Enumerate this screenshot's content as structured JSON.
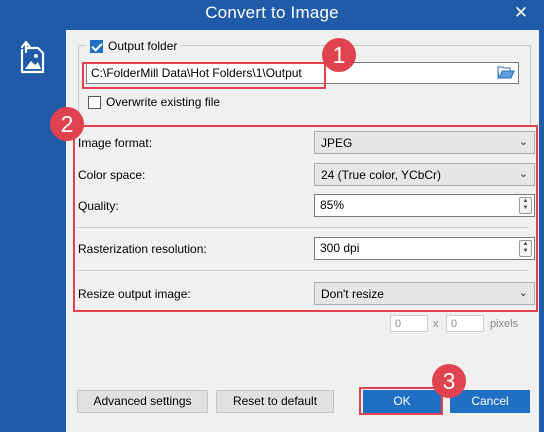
{
  "window": {
    "title": "Convert to Image",
    "close_symbol": "✕"
  },
  "output": {
    "checkbox_label": "Output folder",
    "checked": true,
    "path": "C:\\FolderMill Data\\Hot Folders\\1\\Output",
    "overwrite_label": "Overwrite existing file",
    "overwrite_checked": false
  },
  "settings": {
    "image_format": {
      "label": "Image format:",
      "value": "JPEG"
    },
    "color_space": {
      "label": "Color space:",
      "value": "24 (True color, YCbCr)"
    },
    "quality": {
      "label": "Quality:",
      "value": "85%"
    },
    "resolution": {
      "label": "Rasterization resolution:",
      "value": "300 dpi"
    },
    "resize": {
      "label": "Resize output image:",
      "value": "Don't resize"
    }
  },
  "dimensions": {
    "width": "0",
    "height": "0",
    "separator": "x",
    "unit": "pixels"
  },
  "buttons": {
    "advanced": "Advanced settings",
    "reset": "Reset to default",
    "ok": "OK",
    "cancel": "Cancel"
  },
  "annotations": {
    "badge1": "1",
    "badge2": "2",
    "badge3": "3"
  },
  "colors": {
    "accent": "#1f5ba8",
    "primary_button": "#1f6fc5",
    "annotation": "#e0434d"
  },
  "icons": {
    "app": "image-export-icon",
    "folder": "open-folder-icon",
    "close": "close-icon"
  }
}
